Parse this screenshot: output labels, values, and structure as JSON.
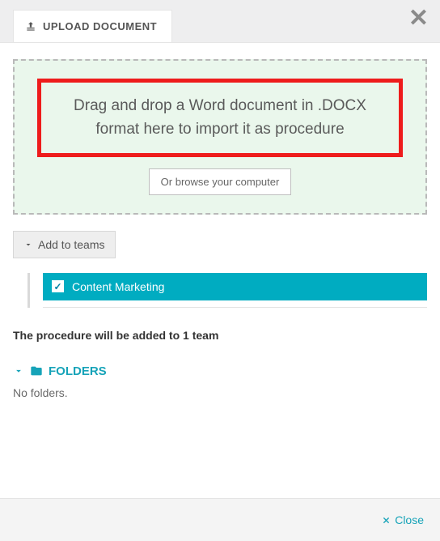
{
  "header": {
    "tabLabel": "UPLOAD DOCUMENT"
  },
  "dropzone": {
    "message": "Drag and drop a Word document in .DOCX format here to import it as procedure",
    "browseLabel": "Or browse your computer"
  },
  "teams": {
    "addLabel": "Add to teams",
    "items": [
      {
        "name": "Content Marketing",
        "checked": true
      }
    ],
    "summary": "The procedure will be added to 1 team"
  },
  "folders": {
    "label": "FOLDERS",
    "emptyText": "No folders."
  },
  "footer": {
    "closeLabel": "Close"
  },
  "colors": {
    "accent": "#16a3b8",
    "teamBg": "#00acc1",
    "highlight": "#ee1c1c",
    "dropzoneBg": "#eaf7ec"
  }
}
